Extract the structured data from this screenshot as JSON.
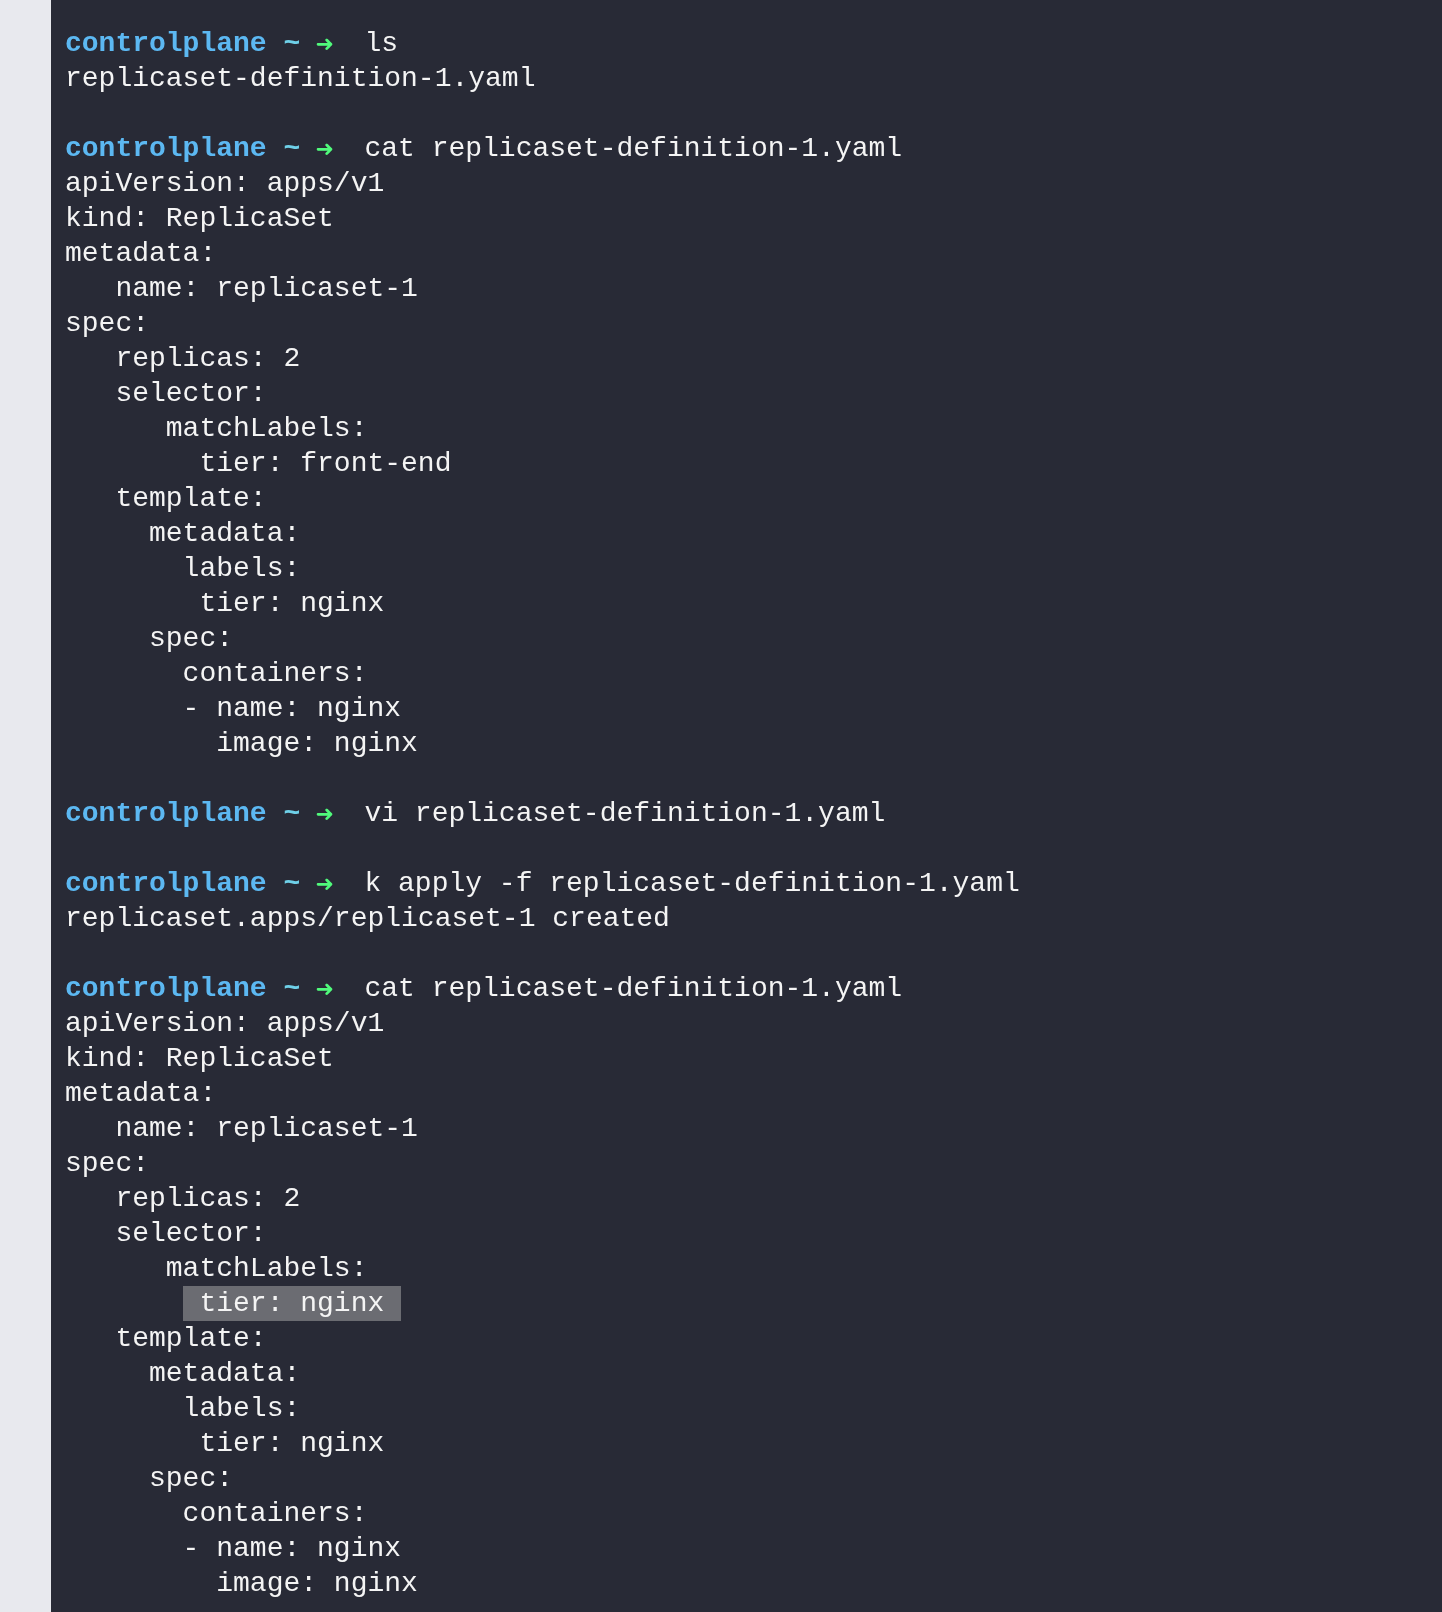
{
  "terminal": {
    "blocks": [
      {
        "prompt": {
          "host": "controlplane",
          "dir": "~",
          "arrow": "➜"
        },
        "command": "ls",
        "output": [
          {
            "text": "replicaset-definition-1.yaml",
            "selected": false
          }
        ]
      },
      {
        "prompt": {
          "host": "controlplane",
          "dir": "~",
          "arrow": "➜"
        },
        "command": "cat replicaset-definition-1.yaml",
        "output": [
          {
            "text": "apiVersion: apps/v1",
            "selected": false
          },
          {
            "text": "kind: ReplicaSet",
            "selected": false
          },
          {
            "text": "metadata:",
            "selected": false
          },
          {
            "text": "   name: replicaset-1",
            "selected": false
          },
          {
            "text": "spec:",
            "selected": false
          },
          {
            "text": "   replicas: 2",
            "selected": false
          },
          {
            "text": "   selector:",
            "selected": false
          },
          {
            "text": "      matchLabels:",
            "selected": false
          },
          {
            "text": "        tier: front-end",
            "selected": false
          },
          {
            "text": "   template:",
            "selected": false
          },
          {
            "text": "     metadata:",
            "selected": false
          },
          {
            "text": "       labels:",
            "selected": false
          },
          {
            "text": "        tier: nginx",
            "selected": false
          },
          {
            "text": "     spec:",
            "selected": false
          },
          {
            "text": "       containers:",
            "selected": false
          },
          {
            "text": "       - name: nginx",
            "selected": false
          },
          {
            "text": "         image: nginx",
            "selected": false
          }
        ]
      },
      {
        "prompt": {
          "host": "controlplane",
          "dir": "~",
          "arrow": "➜"
        },
        "command": "vi replicaset-definition-1.yaml"
      },
      {
        "prompt": {
          "host": "controlplane",
          "dir": "~",
          "arrow": "➜"
        },
        "command": "k apply -f replicaset-definition-1.yaml",
        "output": [
          {
            "text": "replicaset.apps/replicaset-1 created",
            "selected": false
          }
        ]
      },
      {
        "prompt": {
          "host": "controlplane",
          "dir": "~",
          "arrow": "➜"
        },
        "command": "cat replicaset-definition-1.yaml",
        "output": [
          {
            "text": "apiVersion: apps/v1",
            "selected": false
          },
          {
            "text": "kind: ReplicaSet",
            "selected": false
          },
          {
            "text": "metadata:",
            "selected": false
          },
          {
            "text": "   name: replicaset-1",
            "selected": false
          },
          {
            "text": "spec:",
            "selected": false
          },
          {
            "text": "   replicas: 2",
            "selected": false
          },
          {
            "text": "   selector:",
            "selected": false
          },
          {
            "text": "      matchLabels:",
            "selected": false
          },
          {
            "text": "        tier: nginx",
            "selected": true
          },
          {
            "text": "   template:",
            "selected": false
          },
          {
            "text": "     metadata:",
            "selected": false
          },
          {
            "text": "       labels:",
            "selected": false
          },
          {
            "text": "        tier: nginx",
            "selected": false
          },
          {
            "text": "     spec:",
            "selected": false
          },
          {
            "text": "       containers:",
            "selected": false
          },
          {
            "text": "       - name: nginx",
            "selected": false
          },
          {
            "text": "         image: nginx",
            "selected": false
          }
        ]
      }
    ]
  }
}
